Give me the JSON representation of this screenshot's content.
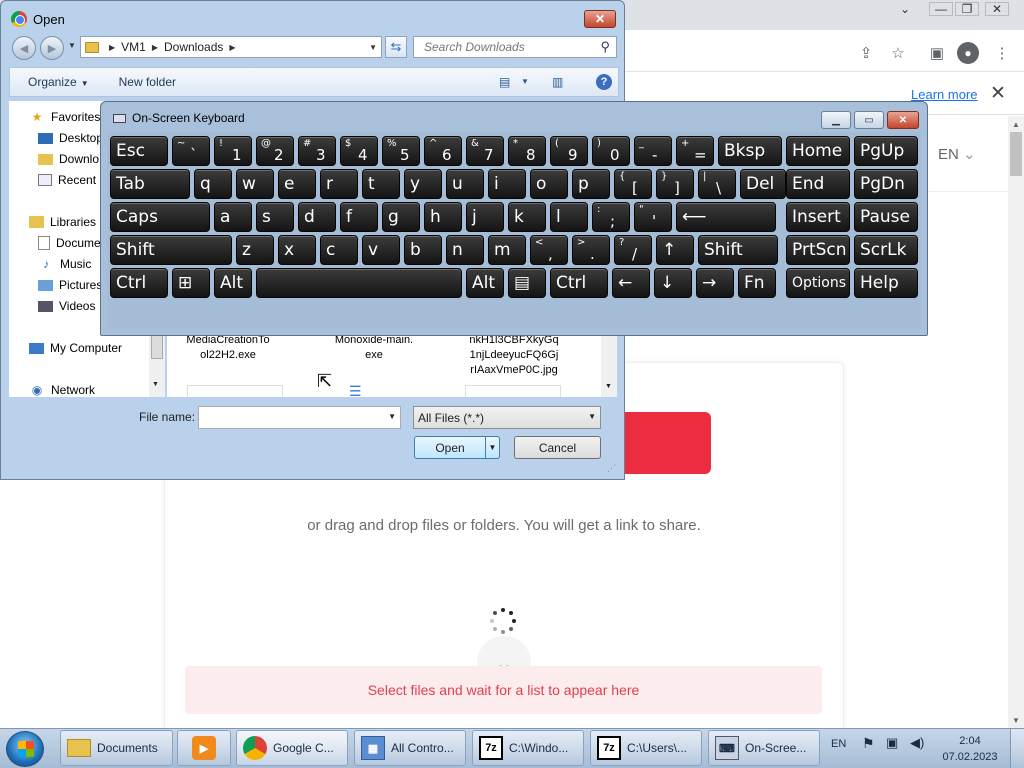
{
  "browser": {
    "learn_more": "Learn more",
    "info_close": "✕",
    "lang": "EN",
    "lang_caret": "⌄",
    "drag_text": "or drag and drop files or folders. You will get a link to share.",
    "select_text": "Select files and wait for a list to appear here",
    "chevron": "⌄",
    "caption_buttons": {
      "dropdown": "⌄",
      "minimize": "—",
      "restore": "❐",
      "close": "✕"
    },
    "toolbar_icons": [
      "share-icon",
      "star-icon",
      "side-panel-icon",
      "profile-icon",
      "menu-icon"
    ],
    "colors": {
      "accent_red": "#eb2d3f",
      "link_blue": "#1a73e8",
      "notice_bg": "#fdeced",
      "notice_text": "#e0404e"
    }
  },
  "open_dialog": {
    "title": "Open",
    "close": "✕",
    "path": [
      "VM1",
      "Downloads"
    ],
    "search_placeholder": "Search Downloads",
    "organize": "Organize",
    "new_folder": "New folder",
    "nav_items": [
      {
        "label": "Favorites",
        "icon": "star-icon"
      },
      {
        "label": "Desktop",
        "icon": "desktop-icon"
      },
      {
        "label": "Downlo",
        "icon": "downloads-folder-icon"
      },
      {
        "label": "Recent P",
        "icon": "recent-places-icon"
      },
      {
        "label": "Libraries",
        "icon": "libraries-icon"
      },
      {
        "label": "Docume",
        "icon": "documents-icon"
      },
      {
        "label": "Music",
        "icon": "music-icon"
      },
      {
        "label": "Pictures",
        "icon": "pictures-icon"
      },
      {
        "label": "Videos",
        "icon": "videos-icon"
      },
      {
        "label": "My Computer",
        "icon": "computer-icon"
      },
      {
        "label": "Network",
        "icon": "network-icon"
      }
    ],
    "files": [
      {
        "line1": "MediaCreationTo",
        "line2": "ol22H2.exe",
        "line3": ""
      },
      {
        "line1": "Monoxide-main.",
        "line2": "exe",
        "line3": ""
      },
      {
        "line1": "nkH1l3CBFXkyGq",
        "line2": "1njLdeeyucFQ6Gj",
        "line3": "rIAaxVmeP0C.jpg"
      }
    ],
    "file_name_label": "File name:",
    "file_name_value": "",
    "filter": "All Files (*.*)",
    "open_button": "Open",
    "cancel_button": "Cancel"
  },
  "osk": {
    "title": "On-Screen Keyboard",
    "rows": [
      [
        {
          "main": "Esc"
        },
        {
          "sub": "~",
          "main": "`"
        },
        {
          "sub": "!",
          "main": "1"
        },
        {
          "sub": "@",
          "main": "2"
        },
        {
          "sub": "#",
          "main": "3"
        },
        {
          "sub": "$",
          "main": "4"
        },
        {
          "sub": "%",
          "main": "5"
        },
        {
          "sub": "^",
          "main": "6"
        },
        {
          "sub": "&",
          "main": "7"
        },
        {
          "sub": "*",
          "main": "8"
        },
        {
          "sub": "(",
          "main": "9"
        },
        {
          "sub": ")",
          "main": "0"
        },
        {
          "sub": "_",
          "main": "-"
        },
        {
          "sub": "+",
          "main": "="
        },
        {
          "main": "Bksp"
        }
      ],
      [
        {
          "main": "Tab"
        },
        {
          "main": "q"
        },
        {
          "main": "w"
        },
        {
          "main": "e"
        },
        {
          "main": "r"
        },
        {
          "main": "t"
        },
        {
          "main": "y"
        },
        {
          "main": "u"
        },
        {
          "main": "i"
        },
        {
          "main": "o"
        },
        {
          "main": "p"
        },
        {
          "sub": "{",
          "main": "["
        },
        {
          "sub": "}",
          "main": "]"
        },
        {
          "sub": "|",
          "main": "\\"
        },
        {
          "main": "Del"
        }
      ],
      [
        {
          "main": "Caps"
        },
        {
          "main": "a"
        },
        {
          "main": "s"
        },
        {
          "main": "d"
        },
        {
          "main": "f"
        },
        {
          "main": "g"
        },
        {
          "main": "h"
        },
        {
          "main": "j"
        },
        {
          "main": "k"
        },
        {
          "main": "l"
        },
        {
          "sub": ":",
          "main": ";"
        },
        {
          "sub": "\"",
          "main": "'"
        },
        {
          "main": "⟵"
        }
      ],
      [
        {
          "main": "Shift"
        },
        {
          "main": "z"
        },
        {
          "main": "x"
        },
        {
          "main": "c"
        },
        {
          "main": "v"
        },
        {
          "main": "b"
        },
        {
          "main": "n"
        },
        {
          "main": "m"
        },
        {
          "sub": "<",
          "main": ","
        },
        {
          "sub": ">",
          "main": "."
        },
        {
          "sub": "?",
          "main": "/"
        },
        {
          "main": "↑"
        },
        {
          "main": "Shift"
        }
      ],
      [
        {
          "main": "Ctrl"
        },
        {
          "main": "⊞"
        },
        {
          "main": "Alt"
        },
        {
          "main": ""
        },
        {
          "main": "Alt"
        },
        {
          "main": "▤"
        },
        {
          "main": "Ctrl"
        },
        {
          "main": "←"
        },
        {
          "main": "↓"
        },
        {
          "main": "→"
        },
        {
          "main": "Fn"
        }
      ]
    ],
    "nav_keys": [
      [
        "Home",
        "PgUp"
      ],
      [
        "End",
        "PgDn"
      ],
      [
        "Insert",
        "Pause"
      ],
      [
        "PrtScn",
        "ScrLk"
      ],
      [
        "Options",
        "Help"
      ]
    ]
  },
  "taskbar": {
    "items": [
      {
        "label": "Documents",
        "icon": "explorer-folder-icon"
      },
      {
        "label": "",
        "icon": "media-player-icon"
      },
      {
        "label": "Google C...",
        "icon": "chrome-icon"
      },
      {
        "label": "All Contro...",
        "icon": "control-panel-icon"
      },
      {
        "label": "C:\\Windo...",
        "icon": "7zip-icon"
      },
      {
        "label": "C:\\Users\\...",
        "icon": "7zip-icon"
      },
      {
        "label": "On-Scree...",
        "icon": "keyboard-icon"
      }
    ],
    "lang": "EN",
    "time": "2:04",
    "date": "07.02.2023"
  }
}
